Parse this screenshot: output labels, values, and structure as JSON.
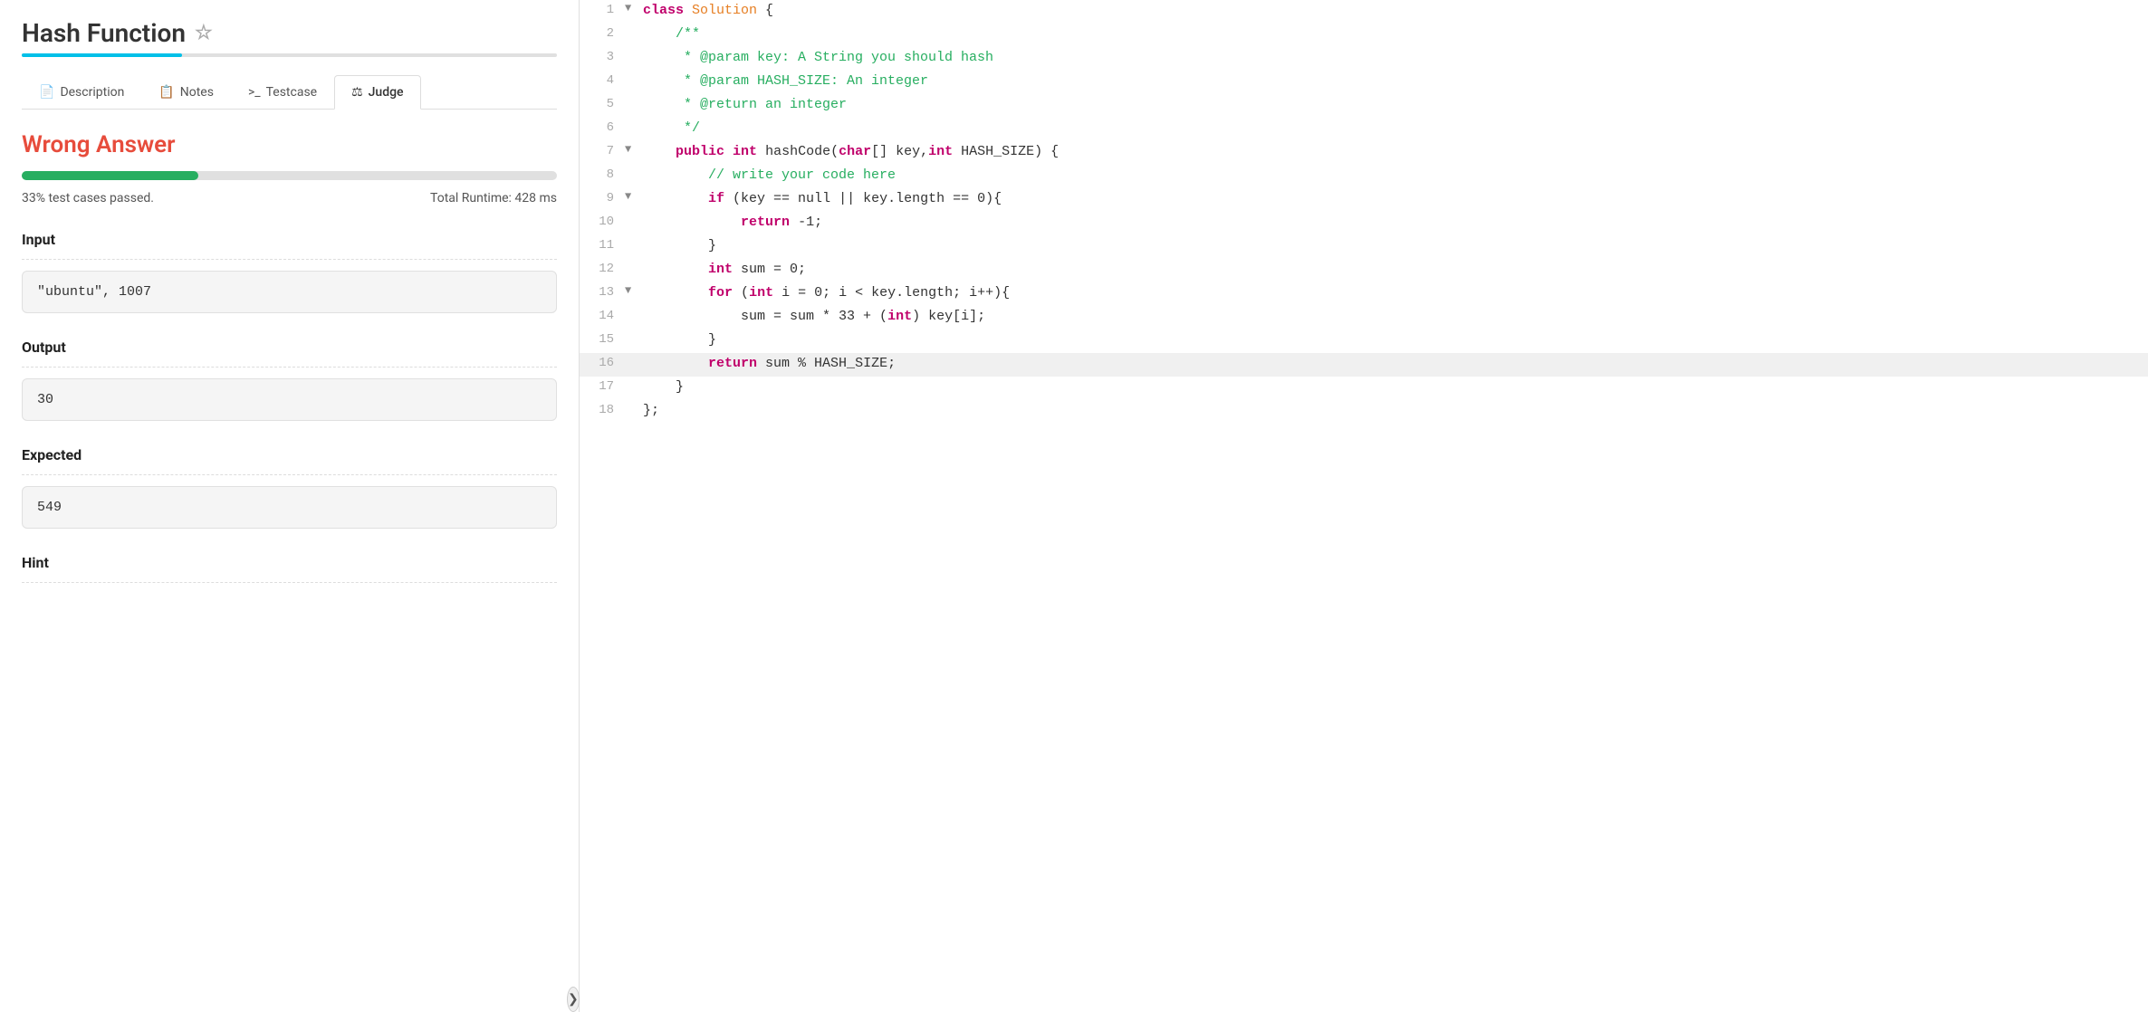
{
  "header": {
    "title": "Hash Function",
    "star_icon": "☆"
  },
  "tabs": [
    {
      "label": "Description",
      "icon": "📄",
      "active": false
    },
    {
      "label": "Notes",
      "icon": "📋",
      "active": false
    },
    {
      "label": "Testcase",
      "icon": ">_",
      "active": false
    },
    {
      "label": "Judge",
      "icon": "⚖",
      "active": true
    }
  ],
  "judge": {
    "status": "Wrong Answer",
    "progress_percent": 33,
    "test_cases_passed": "33% test cases passed.",
    "total_runtime": "Total Runtime: 428 ms",
    "input_label": "Input",
    "input_value": "\"ubuntu\", 1007",
    "output_label": "Output",
    "output_value": "30",
    "expected_label": "Expected",
    "expected_value": "549",
    "hint_label": "Hint"
  },
  "editor": {
    "lines": [
      {
        "num": 1,
        "arrow": "▼",
        "content": "class Solution {",
        "highlight": false
      },
      {
        "num": 2,
        "arrow": "",
        "content": "    /**",
        "highlight": false
      },
      {
        "num": 3,
        "arrow": "",
        "content": "     * @param key: A String you should hash",
        "highlight": false
      },
      {
        "num": 4,
        "arrow": "",
        "content": "     * @param HASH_SIZE: An integer",
        "highlight": false
      },
      {
        "num": 5,
        "arrow": "",
        "content": "     * @return an integer",
        "highlight": false
      },
      {
        "num": 6,
        "arrow": "",
        "content": "     */",
        "highlight": false
      },
      {
        "num": 7,
        "arrow": "▼",
        "content": "    public int hashCode(char[] key,int HASH_SIZE) {",
        "highlight": false
      },
      {
        "num": 8,
        "arrow": "",
        "content": "        // write your code here",
        "highlight": false
      },
      {
        "num": 9,
        "arrow": "▼",
        "content": "        if (key == null || key.length == 0){",
        "highlight": false
      },
      {
        "num": 10,
        "arrow": "",
        "content": "            return -1;",
        "highlight": false
      },
      {
        "num": 11,
        "arrow": "",
        "content": "        }",
        "highlight": false
      },
      {
        "num": 12,
        "arrow": "",
        "content": "        int sum = 0;",
        "highlight": false
      },
      {
        "num": 13,
        "arrow": "▼",
        "content": "        for (int i = 0; i < key.length; i++){",
        "highlight": false
      },
      {
        "num": 14,
        "arrow": "",
        "content": "            sum = sum * 33 + (int) key[i];",
        "highlight": false
      },
      {
        "num": 15,
        "arrow": "",
        "content": "        }",
        "highlight": false
      },
      {
        "num": 16,
        "arrow": "",
        "content": "        return sum % HASH_SIZE;",
        "highlight": true
      },
      {
        "num": 17,
        "arrow": "",
        "content": "    }",
        "highlight": false
      },
      {
        "num": 18,
        "arrow": "",
        "content": "};",
        "highlight": false
      }
    ]
  },
  "collapse_btn": "❯"
}
